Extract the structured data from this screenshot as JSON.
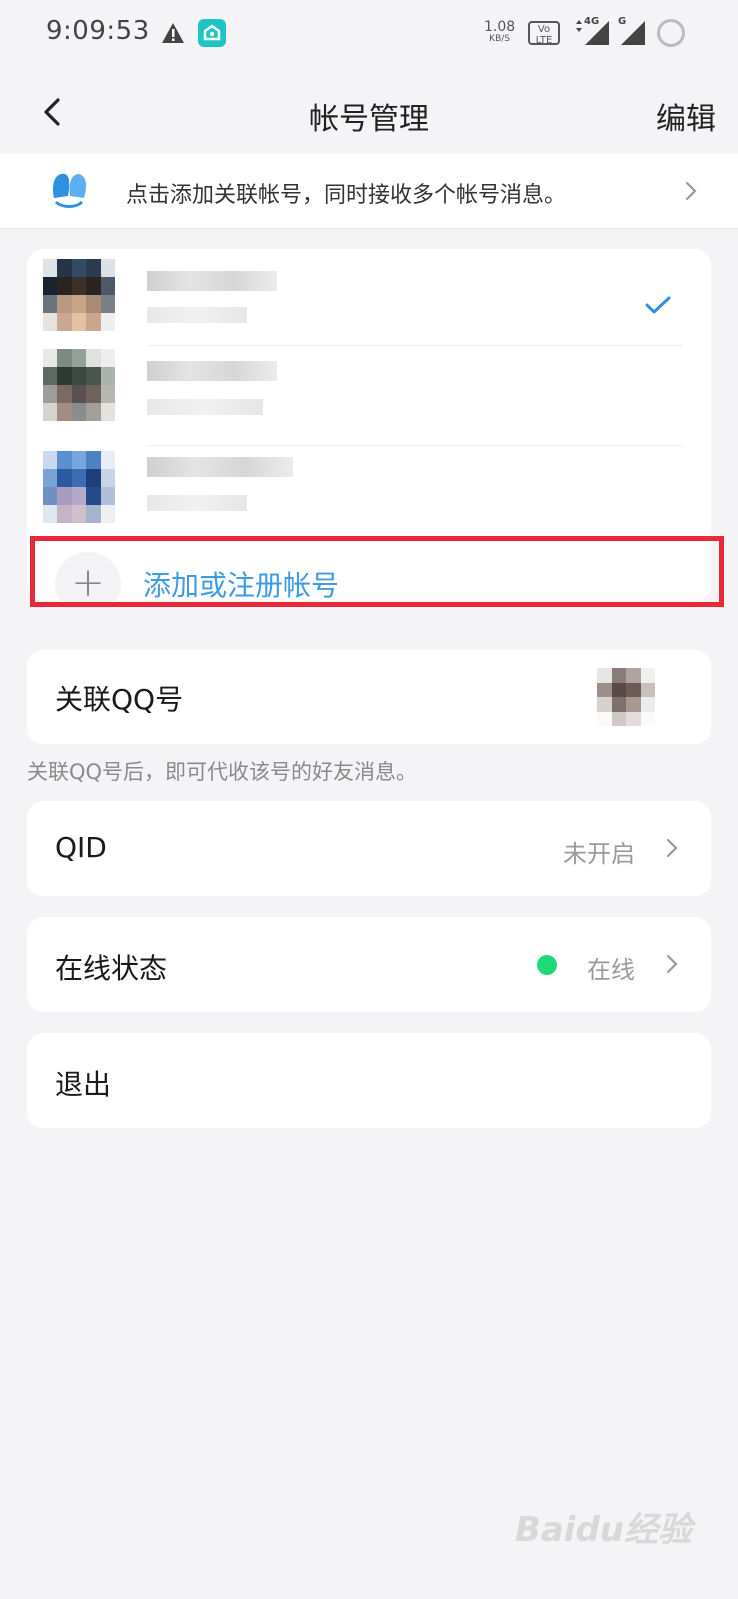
{
  "status_bar": {
    "time": "9:09:53",
    "net_speed_value": "1.08",
    "net_speed_unit": "KB/S",
    "volte_top": "Vo",
    "volte_bottom": "LTE",
    "net_4g": "4G",
    "net_g": "G"
  },
  "nav": {
    "title": "帐号管理",
    "edit_label": "编辑"
  },
  "banner": {
    "text": "点击添加关联帐号，同时接收多个帐号消息。"
  },
  "accounts": {
    "add_label": "添加或注册帐号",
    "add_symbol": "+",
    "check_icon": "checkmark-icon"
  },
  "linked_qq": {
    "label": "关联QQ号",
    "hint": "关联QQ号后，即可代收该号的好友消息。"
  },
  "qid": {
    "label": "QID",
    "value": "未开启"
  },
  "online_status": {
    "label": "在线状态",
    "value": "在线",
    "dot_color": "#1fd878"
  },
  "logout": {
    "label": "退出"
  },
  "watermark": {
    "text": "Baidu经验"
  },
  "colors": {
    "accent": "#3f9ae0",
    "highlight": "#e8293a",
    "background": "#f4f4f6"
  }
}
